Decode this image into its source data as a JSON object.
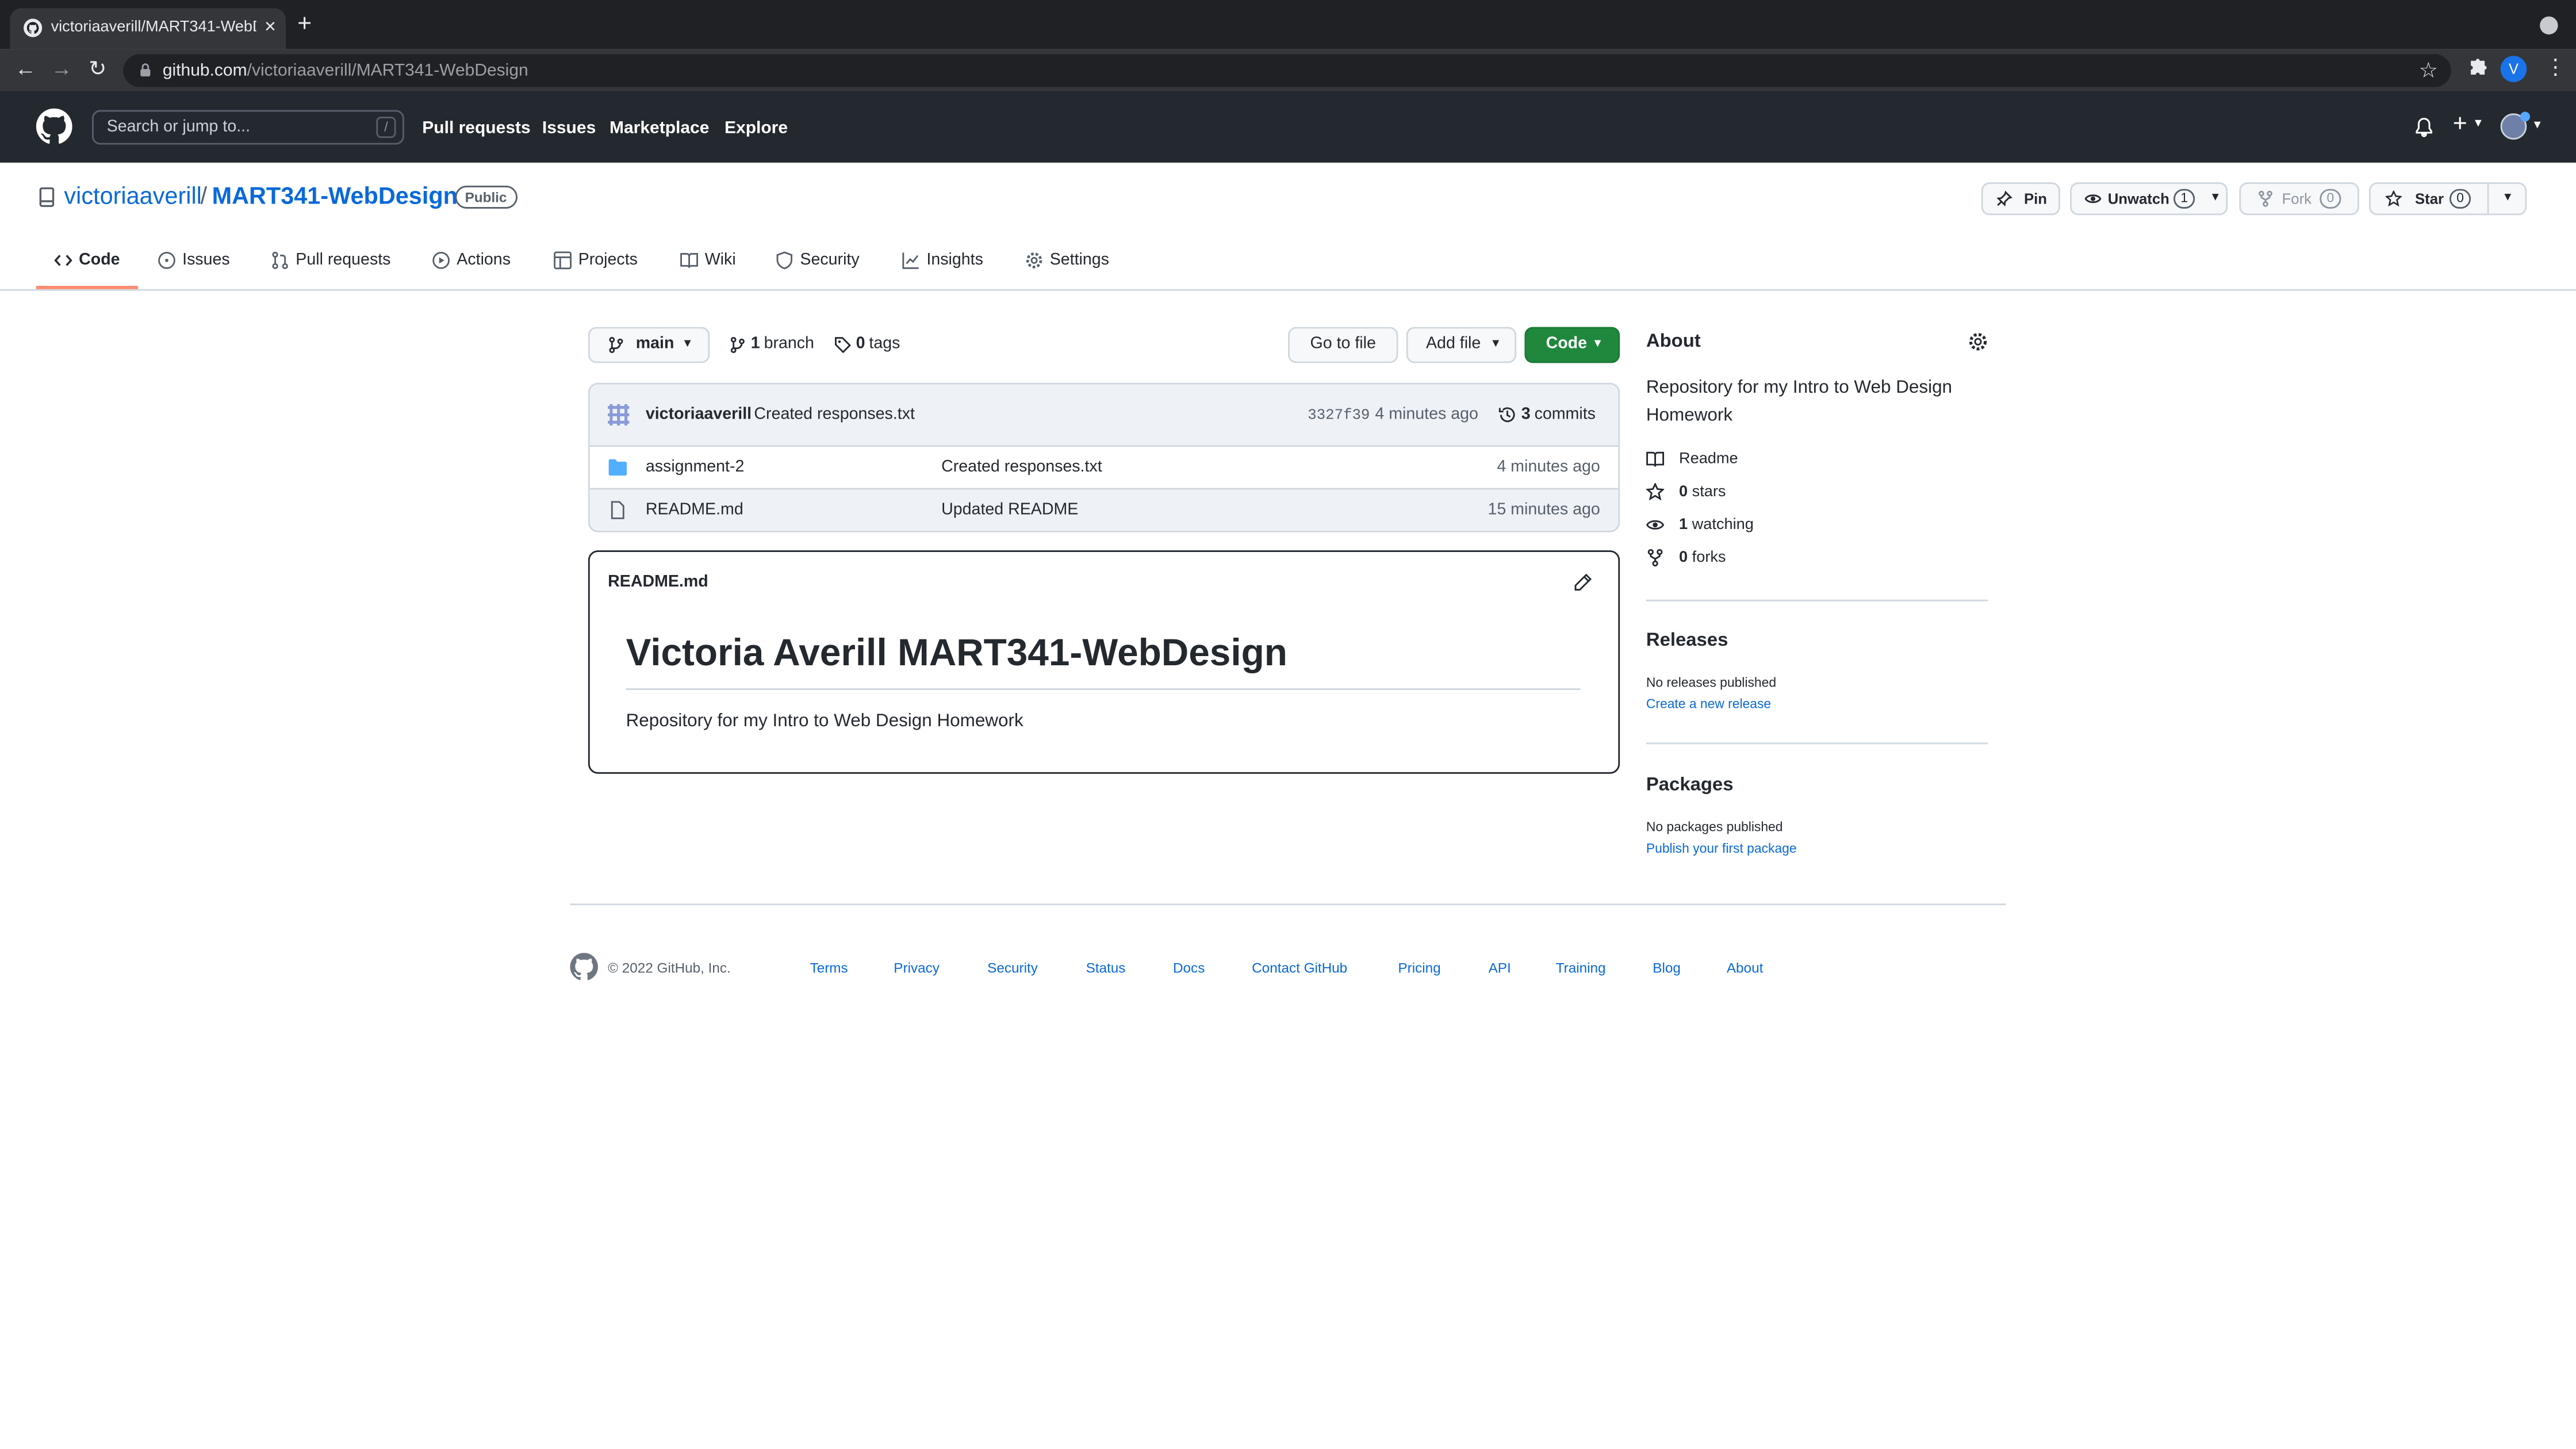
{
  "browser": {
    "tab_title": "victoriaaverill/MART341-WebD",
    "url_host": "github.com",
    "url_path": "/victoriaaverill/MART341-WebDesign",
    "profile_initial": "V"
  },
  "github_header": {
    "search_placeholder": "Search or jump to...",
    "search_shortcut": "/",
    "nav": [
      "Pull requests",
      "Issues",
      "Marketplace",
      "Explore"
    ]
  },
  "repo": {
    "owner": "victoriaaverill",
    "separator": "/",
    "name": "MART341-WebDesign",
    "visibility": "Public",
    "actions": {
      "pin": "Pin",
      "unwatch": "Unwatch",
      "watch_count": "1",
      "fork": "Fork",
      "fork_count": "0",
      "star": "Star",
      "star_count": "0"
    },
    "tabs": [
      "Code",
      "Issues",
      "Pull requests",
      "Actions",
      "Projects",
      "Wiki",
      "Security",
      "Insights",
      "Settings"
    ],
    "active_tab": "Code"
  },
  "toolbar": {
    "branch": "main",
    "branches_count": "1",
    "branches_label": "branch",
    "tags_count": "0",
    "tags_label": "tags",
    "go_to_file": "Go to file",
    "add_file": "Add file",
    "code": "Code"
  },
  "latest_commit": {
    "author": "victoriaaverill",
    "message": "Created responses.txt",
    "hash": "3327f39",
    "time": "4 minutes ago",
    "commits_count": "3",
    "commits_label": "commits"
  },
  "files": [
    {
      "type": "folder",
      "name": "assignment-2",
      "message": "Created responses.txt",
      "age": "4 minutes ago"
    },
    {
      "type": "file",
      "name": "README.md",
      "message": "Updated README",
      "age": "15 minutes ago"
    }
  ],
  "readme": {
    "filename": "README.md",
    "heading": "Victoria Averill MART341-WebDesign",
    "body": "Repository for my Intro to Web Design Homework"
  },
  "about": {
    "title": "About",
    "description": "Repository for my Intro to Web Design Homework",
    "readme_label": "Readme",
    "stars_count": "0",
    "stars_label": "stars",
    "watching_count": "1",
    "watching_label": "watching",
    "forks_count": "0",
    "forks_label": "forks"
  },
  "releases": {
    "title": "Releases",
    "note": "No releases published",
    "link": "Create a new release"
  },
  "packages": {
    "title": "Packages",
    "note": "No packages published",
    "link": "Publish your first package"
  },
  "footer": {
    "copyright": "© 2022 GitHub, Inc.",
    "links": [
      "Terms",
      "Privacy",
      "Security",
      "Status",
      "Docs",
      "Contact GitHub",
      "Pricing",
      "API",
      "Training",
      "Blog",
      "About"
    ]
  },
  "colors": {
    "accent_link": "#0969da",
    "code_button": "#1f883d",
    "active_tab_underline": "#fd8c73",
    "header_bg": "#24292f"
  }
}
